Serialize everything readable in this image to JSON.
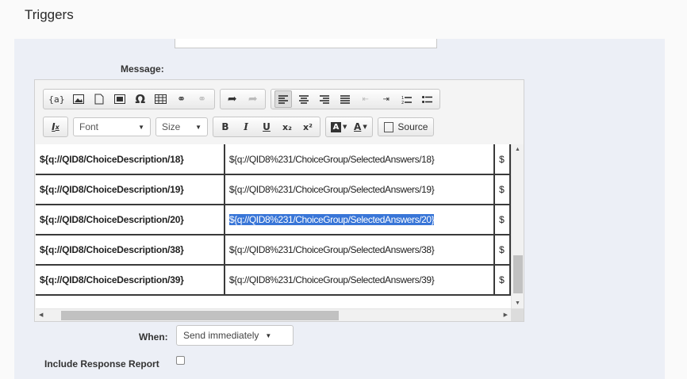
{
  "page": {
    "title": "Triggers"
  },
  "form": {
    "message_label": "Message:",
    "when_label": "When:",
    "when_value": "Send immediately",
    "include_label": "Include Response Report",
    "include_checked": false
  },
  "toolbar": {
    "row1_groups": [
      [
        "{a}",
        "image-icon",
        "page-icon",
        "media-icon",
        "Ω",
        "table-icon",
        "link-icon",
        "unlink-icon"
      ],
      [
        "undo-icon",
        "redo-icon"
      ],
      [
        "align-left-icon",
        "align-center-icon",
        "align-right-icon",
        "justify-icon",
        "outdent-icon",
        "indent-icon",
        "numbered-list-icon",
        "bullet-list-icon"
      ]
    ],
    "clear_format": "I",
    "font_label": "Font",
    "size_label": "Size",
    "bold": "B",
    "italic": "I",
    "underline": "U",
    "subscript": "x₂",
    "superscript": "x²",
    "source_label": "Source"
  },
  "table": {
    "rows": [
      {
        "c1": "${q://QID8/ChoiceDescription/18}",
        "c2": "${q://QID8%231/ChoiceGroup/SelectedAnswers/18}",
        "c3": "$",
        "selected": false
      },
      {
        "c1": "${q://QID8/ChoiceDescription/19}",
        "c2": "${q://QID8%231/ChoiceGroup/SelectedAnswers/19}",
        "c3": "$",
        "selected": false
      },
      {
        "c1": "${q://QID8/ChoiceDescription/20}",
        "c2": "${q://QID8%231/ChoiceGroup/SelectedAnswers/20}",
        "c3": "$",
        "selected": true
      },
      {
        "c1": "${q://QID8/ChoiceDescription/38}",
        "c2": "${q://QID8%231/ChoiceGroup/SelectedAnswers/38}",
        "c3": "$",
        "selected": false
      },
      {
        "c1": "${q://QID8/ChoiceDescription/39}",
        "c2": "${q://QID8%231/ChoiceGroup/SelectedAnswers/39}",
        "c3": "$",
        "selected": false
      }
    ]
  }
}
